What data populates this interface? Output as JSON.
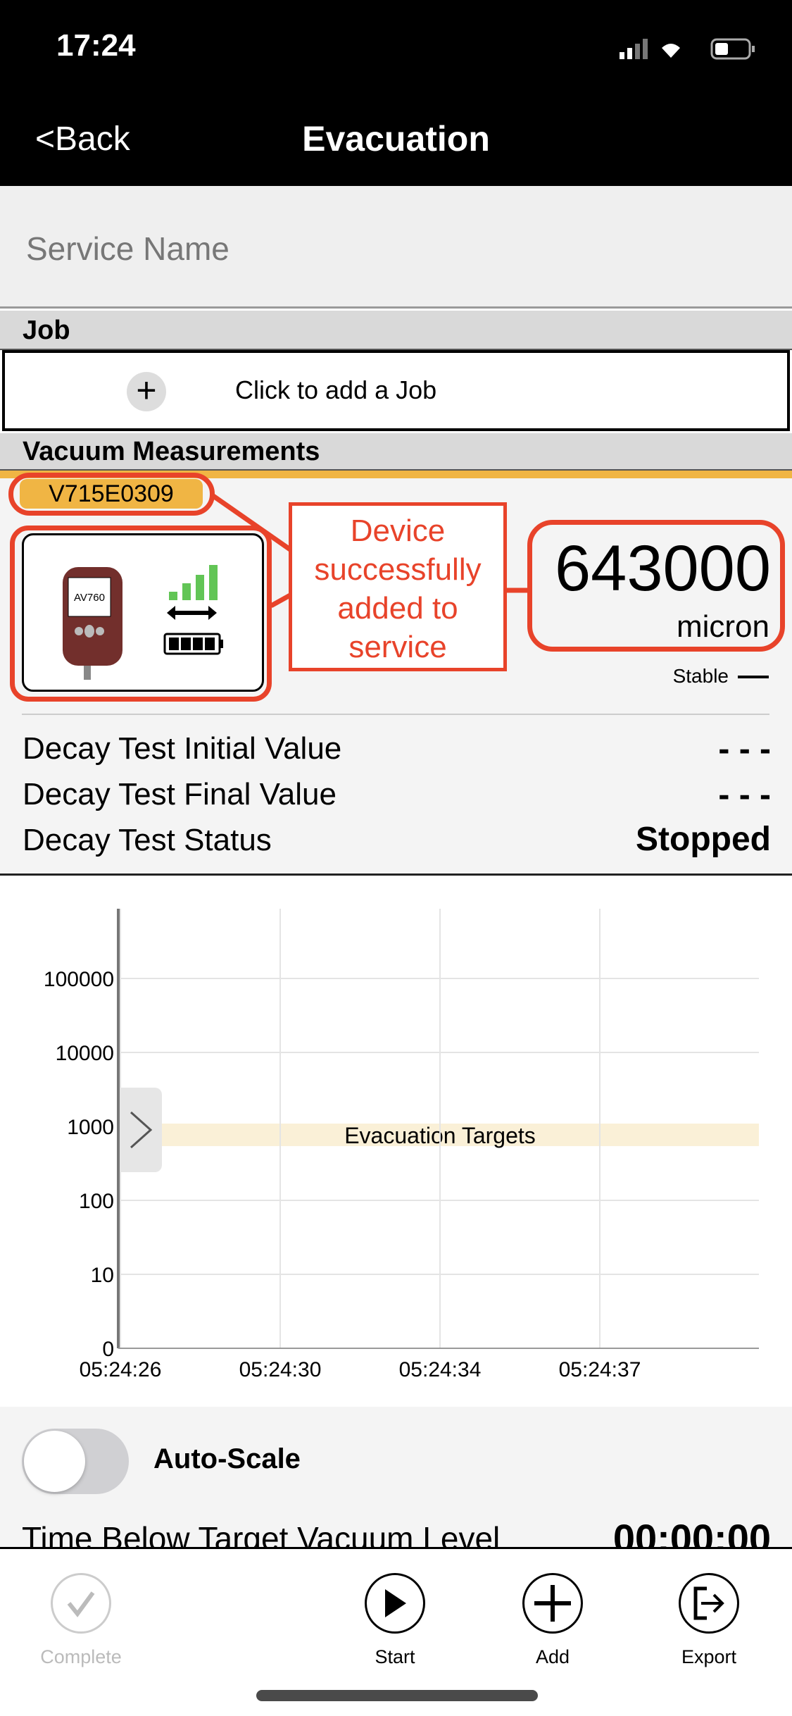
{
  "status_bar": {
    "time": "17:24"
  },
  "nav": {
    "back": "<Back",
    "title": "Evacuation"
  },
  "service_name": {
    "placeholder": "Service Name"
  },
  "job": {
    "header": "Job",
    "add_label": "Click to add a Job"
  },
  "vacuum": {
    "header": "Vacuum Measurements",
    "serial": "V715E0309",
    "device_model": "AV760",
    "reading": "643000",
    "unit": "micron",
    "stability": "Stable",
    "callout": "Device successfully added to service",
    "accent_color": "#f0b544",
    "annotation_color": "#e8432a"
  },
  "decay": [
    {
      "label": "Decay Test Initial Value",
      "value": "- - -"
    },
    {
      "label": "Decay Test Final Value",
      "value": "- - -"
    },
    {
      "label": "Decay Test Status",
      "value": "Stopped"
    }
  ],
  "chart_data": {
    "type": "line",
    "yscale": "log",
    "y_ticks": [
      "100000",
      "10000",
      "1000",
      "100",
      "10",
      "0"
    ],
    "x_ticks": [
      "05:24:26",
      "05:24:30",
      "05:24:34",
      "05:24:37"
    ],
    "band_label": "Evacuation Targets",
    "band_color": "#faf0d7",
    "grid": true,
    "series": []
  },
  "auto_scale": {
    "label": "Auto-Scale",
    "enabled": false
  },
  "time_below": {
    "label": "Time Below Target Vacuum Level",
    "value": "00:00:00"
  },
  "toolbar": {
    "complete": "Complete",
    "start": "Start",
    "add": "Add",
    "export": "Export"
  }
}
